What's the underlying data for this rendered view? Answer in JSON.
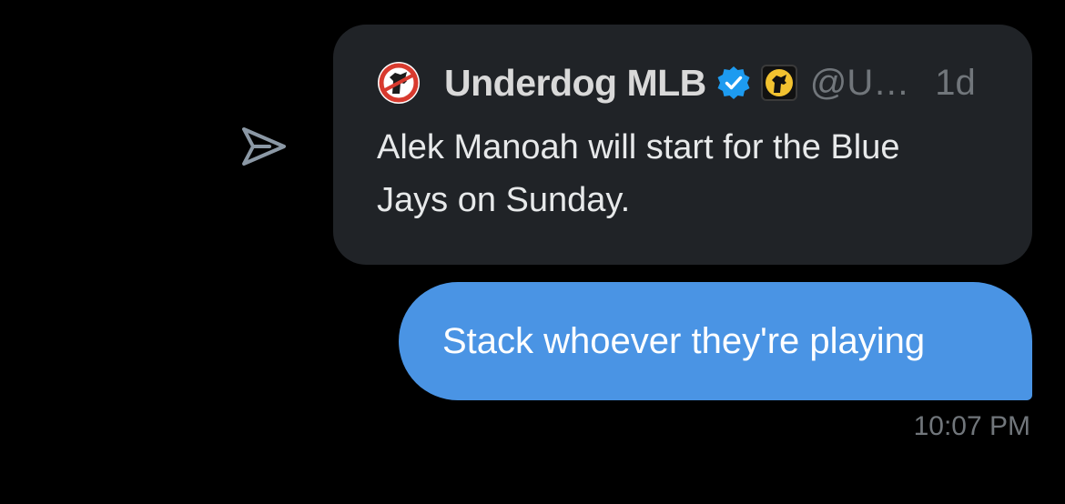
{
  "share": {
    "icon": "send-arrow-icon",
    "color": "#8b98a5"
  },
  "quote": {
    "author_name": "Underdog MLB",
    "handle": "@U…",
    "time_ago": "1d",
    "text": "Alek Manoah will start for the Blue Jays on Sunday.",
    "avatar_icon": "underdog-logo-icon",
    "verified_icon": "verified-badge-icon",
    "affiliate_icon": "underdog-affiliate-badge-icon",
    "colors": {
      "card_bg": "#202327",
      "name": "#d9d9d9",
      "meta": "#71767b",
      "body": "#e7e9ea",
      "verified": "#1d9bf0"
    }
  },
  "message": {
    "text": "Stack whoever they're playing",
    "time": "10:07 PM",
    "bubble_color": "#4a94e4"
  }
}
